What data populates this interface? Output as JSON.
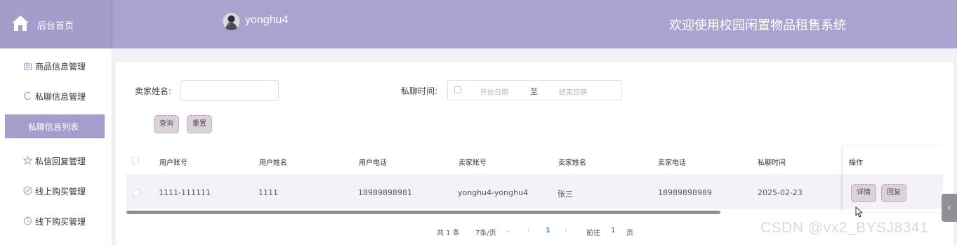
{
  "header": {
    "home_label": "后台首页",
    "username": "yonghu4",
    "site_title": "欢迎使用校园闲置物品租售系统"
  },
  "sidebar": {
    "items": [
      {
        "label": "商品信息管理",
        "icon": "gift-icon"
      },
      {
        "label": "私聊信息管理",
        "icon": "chat-icon"
      },
      {
        "label": "私聊信息列表",
        "icon": "",
        "active": true
      },
      {
        "label": "私信回复管理",
        "icon": "star-icon"
      },
      {
        "label": "线上购买管理",
        "icon": "compass-icon"
      },
      {
        "label": "线下购买管理",
        "icon": "clock-icon"
      }
    ]
  },
  "search": {
    "seller_name_label": "卖家姓名:",
    "seller_name_value": "",
    "chat_time_label": "私聊时间:",
    "start_placeholder": "开始日期",
    "range_separator": "至",
    "end_placeholder": "结束日期",
    "query_button": "查询",
    "reset_button": "重置"
  },
  "table": {
    "columns": [
      "用户账号",
      "用户姓名",
      "用户电话",
      "卖家账号",
      "卖家姓名",
      "卖家电话",
      "私聊时间",
      "操作"
    ],
    "rows": [
      {
        "user_account": "1111-111111",
        "user_name": "1111",
        "user_phone": "18989898981",
        "seller_account": "yonghu4-yonghu4",
        "seller_name": "张三",
        "seller_phone": "18989898989",
        "chat_time": "2025-02-23",
        "actions": {
          "detail": "详情",
          "reply": "回复"
        }
      }
    ]
  },
  "pagination": {
    "total": "共 1 条",
    "page_size": "7条/页",
    "current_page": "1",
    "goto_label": "前往",
    "goto_value": "1",
    "page_unit": "页"
  },
  "watermark": "CSDN @vx2_BYSJ8341",
  "colors": {
    "header_bg": "#a9a4cf",
    "sidebar_active": "#a49ecd",
    "button_bg": "#dcd2dc",
    "page_bg": "#f2f1f6"
  }
}
